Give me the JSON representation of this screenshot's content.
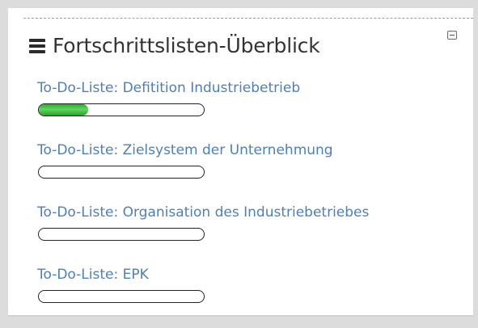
{
  "block": {
    "title": "Fortschrittslisten-Überblick",
    "menu_icon": "hamburger-menu-icon",
    "collapse_icon": "minus-square-icon"
  },
  "colors": {
    "link": "#4f7fb7",
    "progress_fill": "#3cb83c"
  },
  "items": [
    {
      "label": "To-Do-Liste: Defitition Industriebetrieb",
      "progress": 0.3
    },
    {
      "label": "To-Do-Liste: Zielsystem der Unternehmung",
      "progress": 0
    },
    {
      "label": "To-Do-Liste: Organisation des Industriebetriebes",
      "progress": 0
    },
    {
      "label": "To-Do-Liste: EPK",
      "progress": 0
    }
  ]
}
